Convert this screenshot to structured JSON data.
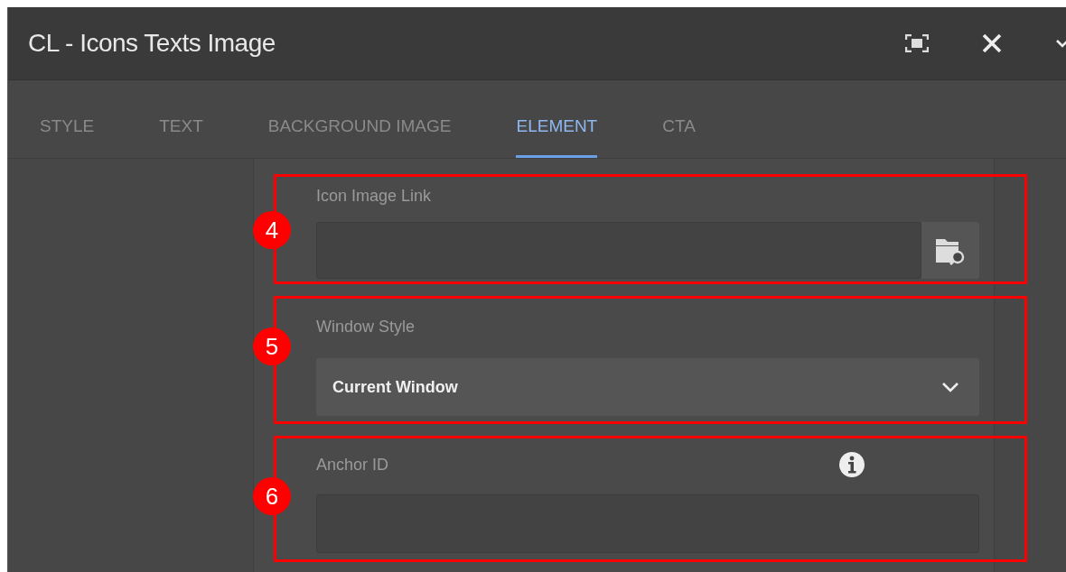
{
  "window": {
    "title": "CL - Icons Texts Image"
  },
  "tabs": [
    {
      "label": "STYLE",
      "selected": false
    },
    {
      "label": "TEXT",
      "selected": false
    },
    {
      "label": "BACKGROUND IMAGE",
      "selected": false
    },
    {
      "label": "ELEMENT",
      "selected": true
    },
    {
      "label": "CTA",
      "selected": false
    }
  ],
  "fields": [
    {
      "kind": "path",
      "annotation": "4",
      "label": "Icon Image Link"
    },
    {
      "kind": "select",
      "annotation": "5",
      "label": "Window Style",
      "value": "Current Window"
    },
    {
      "kind": "text",
      "annotation": "6",
      "label": "Anchor ID",
      "info": true
    }
  ]
}
